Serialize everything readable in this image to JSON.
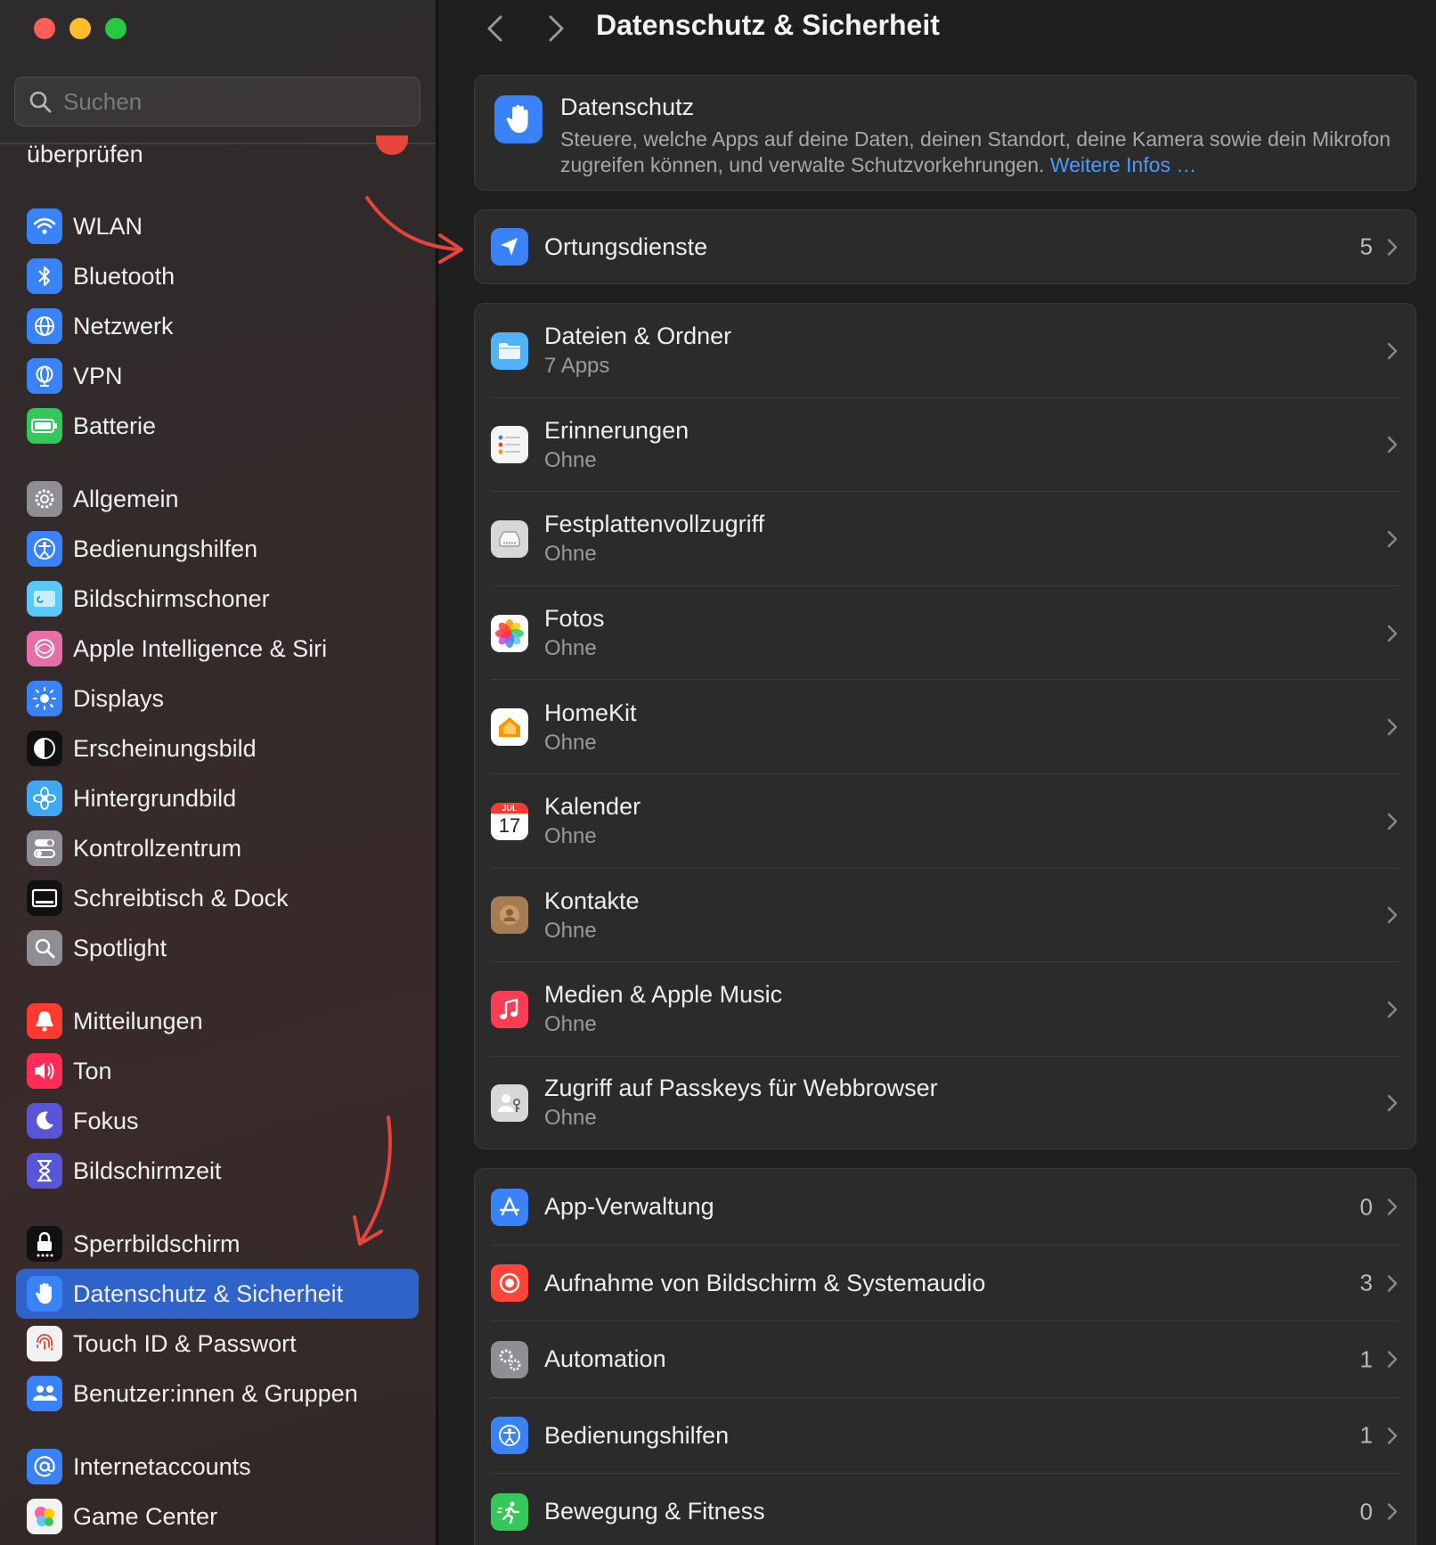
{
  "sidebar": {
    "search_placeholder": "Suchen",
    "cut_item": "überprüfen",
    "groups": [
      [
        {
          "label": "WLAN",
          "icon": "wifi-icon",
          "color": "#3a82f7"
        },
        {
          "label": "Bluetooth",
          "icon": "bluetooth-icon",
          "color": "#3a82f7"
        },
        {
          "label": "Netzwerk",
          "icon": "globe-icon",
          "color": "#3a82f7"
        },
        {
          "label": "VPN",
          "icon": "vpn-globe-icon",
          "color": "#3a82f7"
        },
        {
          "label": "Batterie",
          "icon": "battery-icon",
          "color": "#34c759"
        }
      ],
      [
        {
          "label": "Allgemein",
          "icon": "gear-icon",
          "color": "#8e8e93"
        },
        {
          "label": "Bedienungshilfen",
          "icon": "accessibility-icon",
          "color": "#3a82f7"
        },
        {
          "label": "Bildschirmschoner",
          "icon": "screensaver-icon",
          "color": "#5ac8fa"
        },
        {
          "label": "Apple Intelligence & Siri",
          "icon": "siri-icon",
          "color": "#e76fa8"
        },
        {
          "label": "Displays",
          "icon": "sun-icon",
          "color": "#3a82f7"
        },
        {
          "label": "Erscheinungsbild",
          "icon": "appearance-icon",
          "color": "#111111"
        },
        {
          "label": "Hintergrundbild",
          "icon": "flower-icon",
          "color": "#3fa8f5"
        },
        {
          "label": "Kontrollzentrum",
          "icon": "toggles-icon",
          "color": "#8e8e93"
        },
        {
          "label": "Schreibtisch & Dock",
          "icon": "dock-icon",
          "color": "#111111"
        },
        {
          "label": "Spotlight",
          "icon": "magnifier-icon",
          "color": "#8e8e93"
        }
      ],
      [
        {
          "label": "Mitteilungen",
          "icon": "bell-icon",
          "color": "#ff3b30"
        },
        {
          "label": "Ton",
          "icon": "speaker-icon",
          "color": "#ff2d55"
        },
        {
          "label": "Fokus",
          "icon": "moon-icon",
          "color": "#5856d6"
        },
        {
          "label": "Bildschirmzeit",
          "icon": "hourglass-icon",
          "color": "#5856d6"
        }
      ],
      [
        {
          "label": "Sperrbildschirm",
          "icon": "lock-icon",
          "color": "#111111"
        },
        {
          "label": "Datenschutz & Sicherheit",
          "icon": "hand-icon",
          "color": "#3a82f7",
          "active": true
        },
        {
          "label": "Touch ID & Passwort",
          "icon": "fingerprint-icon",
          "color": "#f2f2f2"
        },
        {
          "label": "Benutzer:innen & Gruppen",
          "icon": "users-icon",
          "color": "#3a82f7"
        }
      ],
      [
        {
          "label": "Internetaccounts",
          "icon": "at-icon",
          "color": "#3a82f7"
        },
        {
          "label": "Game Center",
          "icon": "gamecenter-icon",
          "color": "#f2f2f2"
        }
      ]
    ]
  },
  "header": {
    "title": "Datenschutz & Sicherheit",
    "back": "‹",
    "forward": "›"
  },
  "privacy": {
    "title": "Datenschutz",
    "description": "Steuere, welche Apps auf deine Daten, deinen Standort, deine Kamera sowie dein Mikrofon zugreifen können, und verwalte Schutzvorkehrungen.",
    "link": "Weitere Infos …"
  },
  "location": {
    "label": "Ortungsdienste",
    "count": "5"
  },
  "data_items": [
    {
      "label": "Dateien & Ordner",
      "sub": "7 Apps",
      "icon": "folder-icon"
    },
    {
      "label": "Erinnerungen",
      "sub": "Ohne",
      "icon": "reminders-icon"
    },
    {
      "label": "Festplattenvollzugriff",
      "sub": "Ohne",
      "icon": "disk-icon"
    },
    {
      "label": "Fotos",
      "sub": "Ohne",
      "icon": "photos-icon"
    },
    {
      "label": "HomeKit",
      "sub": "Ohne",
      "icon": "home-icon"
    },
    {
      "label": "Kalender",
      "sub": "Ohne",
      "icon": "calendar-icon",
      "calendar_month": "JUL",
      "calendar_day": "17"
    },
    {
      "label": "Kontakte",
      "sub": "Ohne",
      "icon": "contacts-icon"
    },
    {
      "label": "Medien & Apple Music",
      "sub": "Ohne",
      "icon": "music-icon"
    },
    {
      "label": "Zugriff auf Passkeys für Webbrowser",
      "sub": "Ohne",
      "icon": "passkey-icon"
    }
  ],
  "system_items": [
    {
      "label": "App-Verwaltung",
      "count": "0",
      "icon": "appstore-icon"
    },
    {
      "label": "Aufnahme von Bildschirm & Systemaudio",
      "count": "3",
      "icon": "record-icon"
    },
    {
      "label": "Automation",
      "count": "1",
      "icon": "gears-icon"
    },
    {
      "label": "Bedienungshilfen",
      "count": "1",
      "icon": "accessibility-icon"
    },
    {
      "label": "Bewegung & Fitness",
      "count": "0",
      "icon": "fitness-icon"
    }
  ],
  "colors": {
    "accent": "#2f63c9",
    "link": "#4a9bff",
    "annotation_arrow": "#e5453a"
  }
}
